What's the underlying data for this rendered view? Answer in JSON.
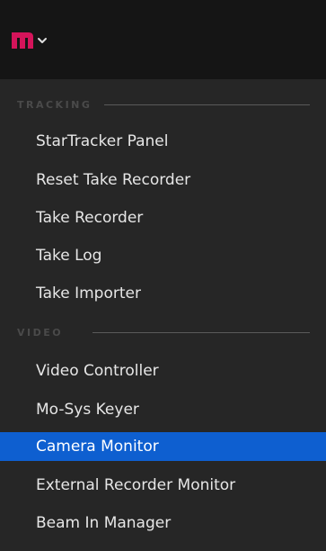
{
  "header": {
    "logo_icon": "mosys-m-logo-icon",
    "caret_icon": "chevron-down-icon",
    "brand_color": "#d4145a"
  },
  "menu": {
    "sections": [
      {
        "label": "TRACKING",
        "items": [
          {
            "label": "StarTracker Panel"
          },
          {
            "label": "Reset Take Recorder"
          },
          {
            "label": "Take Recorder"
          },
          {
            "label": "Take Log"
          },
          {
            "label": "Take Importer"
          }
        ]
      },
      {
        "label": "VIDEO",
        "items": [
          {
            "label": "Video Controller"
          },
          {
            "label": "Mo-Sys Keyer"
          },
          {
            "label": "Camera Monitor",
            "selected": true
          },
          {
            "label": "External Recorder Monitor"
          },
          {
            "label": "Beam In Manager"
          }
        ]
      }
    ],
    "selected_color": "#0e5fd0"
  }
}
